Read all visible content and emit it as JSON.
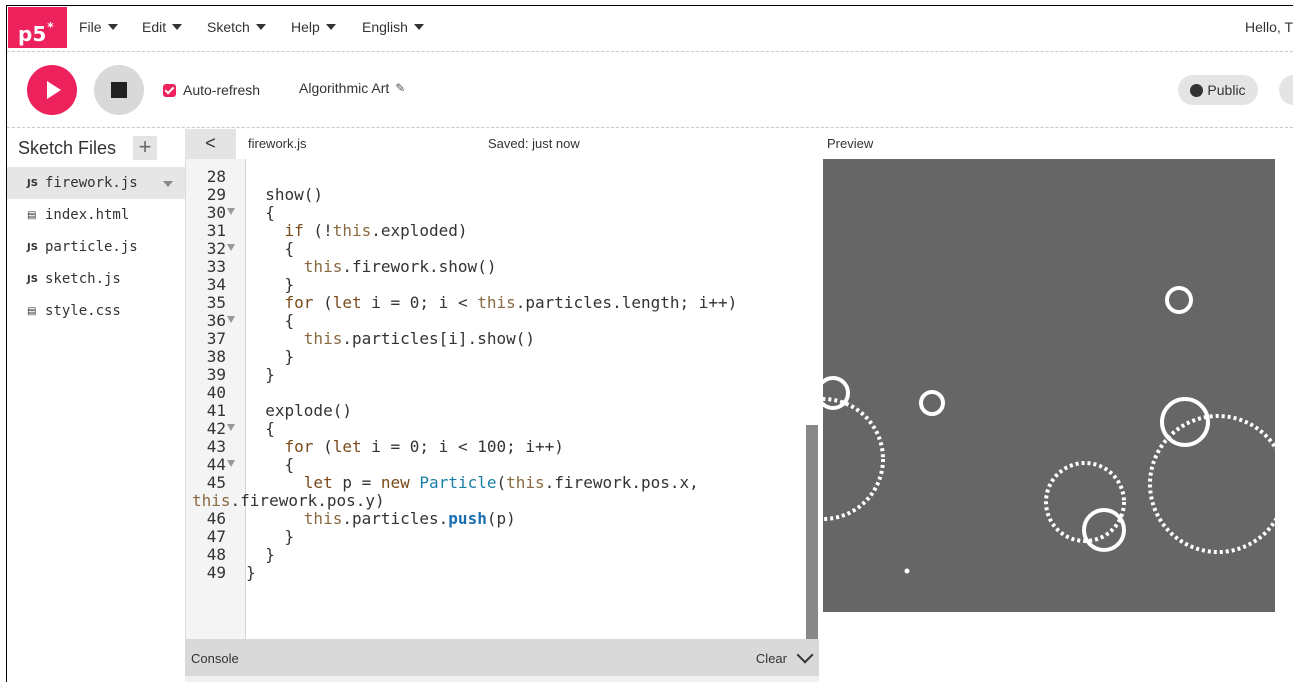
{
  "nav": {
    "logo": "p5",
    "logo_mark": "*",
    "menus": [
      {
        "label": "File"
      },
      {
        "label": "Edit"
      },
      {
        "label": "Sketch"
      },
      {
        "label": "Help"
      },
      {
        "label": "English"
      }
    ],
    "greeting": "Hello, T"
  },
  "toolbar": {
    "auto_refresh_label": "Auto-refresh",
    "auto_refresh_checked": true,
    "sketch_name": "Algorithmic Art",
    "visibility_label": "Public",
    "play_icon": "play-icon",
    "stop_icon": "stop-icon"
  },
  "sidebar": {
    "title": "Sketch Files",
    "add_label": "+",
    "files": [
      {
        "name": "firework.js",
        "type": "JS"
      },
      {
        "name": "index.html",
        "type": "html"
      },
      {
        "name": "particle.js",
        "type": "JS"
      },
      {
        "name": "sketch.js",
        "type": "JS"
      },
      {
        "name": "style.css",
        "type": "css"
      }
    ]
  },
  "editor": {
    "back_label": "<",
    "filename": "firework.js",
    "save_status": "Saved: just now",
    "lines": [
      {
        "n": "28",
        "t": ""
      },
      {
        "n": "29",
        "t": "  show()"
      },
      {
        "n": "30",
        "t": "  {",
        "fold": true
      },
      {
        "n": "31",
        "t": "    if (!this.exploded)"
      },
      {
        "n": "32",
        "t": "    {",
        "fold": true
      },
      {
        "n": "33",
        "t": "      this.firework.show()"
      },
      {
        "n": "34",
        "t": "    }"
      },
      {
        "n": "35",
        "t": "    for (let i = 0; i < this.particles.length; i++)"
      },
      {
        "n": "36",
        "t": "    {",
        "fold": true
      },
      {
        "n": "37",
        "t": "      this.particles[i].show()"
      },
      {
        "n": "38",
        "t": "    }"
      },
      {
        "n": "39",
        "t": "  }"
      },
      {
        "n": "40",
        "t": ""
      },
      {
        "n": "41",
        "t": "  explode()"
      },
      {
        "n": "42",
        "t": "  {",
        "fold": true
      },
      {
        "n": "43",
        "t": "    for (let i = 0; i < 100; i++)"
      },
      {
        "n": "44",
        "t": "    {",
        "fold": true
      },
      {
        "n": "45",
        "t": "      let p = new Particle(this.firework.pos.x,"
      },
      {
        "n": "",
        "t": "this.firework.pos.y)"
      },
      {
        "n": "46",
        "t": "      this.particles.push(p)"
      },
      {
        "n": "47",
        "t": "    }"
      },
      {
        "n": "48",
        "t": "  }"
      },
      {
        "n": "49",
        "t": "}"
      }
    ]
  },
  "console": {
    "title": "Console",
    "clear_label": "Clear"
  },
  "preview": {
    "label": "Preview"
  },
  "colors": {
    "accent": "#ed225d",
    "canvas_bg": "#666666",
    "particle": "#ffffff"
  }
}
